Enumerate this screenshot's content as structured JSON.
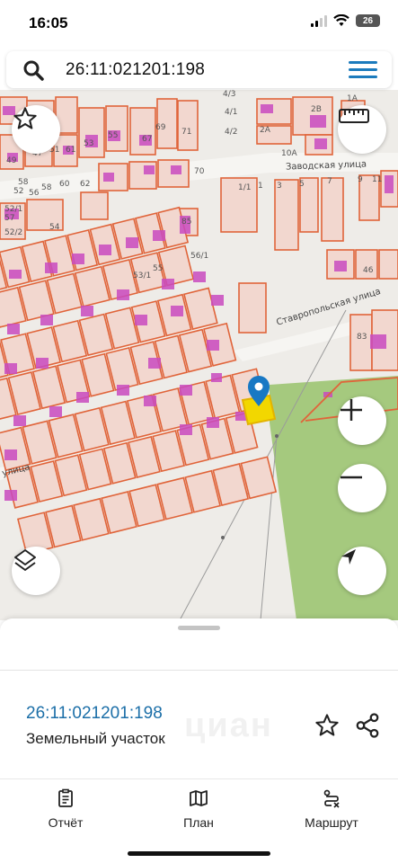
{
  "status_bar": {
    "time": "16:05",
    "battery": "26"
  },
  "search": {
    "value": "26:11:021201:198"
  },
  "map": {
    "streets": [
      "Заводская улица",
      "Ставропольская улица",
      "улица"
    ],
    "labels": [
      "4/3",
      "4/1",
      "4/2",
      "2А",
      "2В",
      "10А",
      "1А",
      "69",
      "71",
      "67",
      "61",
      "53",
      "55",
      "49",
      "47",
      "51",
      "70",
      "60",
      "62",
      "58",
      "56",
      "52",
      "52/1",
      "52/2",
      "54",
      "1/1",
      "1",
      "3",
      "5",
      "7",
      "9",
      "11",
      "46",
      "83",
      "85",
      "53/1",
      "55",
      "56/1",
      "58",
      "57"
    ],
    "buttons": {
      "favorite": "star-icon",
      "ruler": "ruler-icon",
      "zoom_in": "plus-icon",
      "zoom_out": "minus-icon",
      "layers": "layers-icon",
      "locate": "navigation-arrow-icon"
    },
    "colors": {
      "parcel_border": "#e0643a",
      "parcel_fill": "#f2d7cf",
      "building": "#c94bc0",
      "selected": "#f2d700",
      "pin": "#1878c4",
      "green_area": "#a5c97e"
    }
  },
  "sheet": {
    "parcel_id": "26:11:021201:198",
    "parcel_type": "Земельный участок",
    "watermark": "циан"
  },
  "nav": {
    "items": [
      {
        "label": "Отчёт",
        "icon": "report-icon"
      },
      {
        "label": "План",
        "icon": "map-icon"
      },
      {
        "label": "Маршрут",
        "icon": "route-icon"
      }
    ]
  }
}
